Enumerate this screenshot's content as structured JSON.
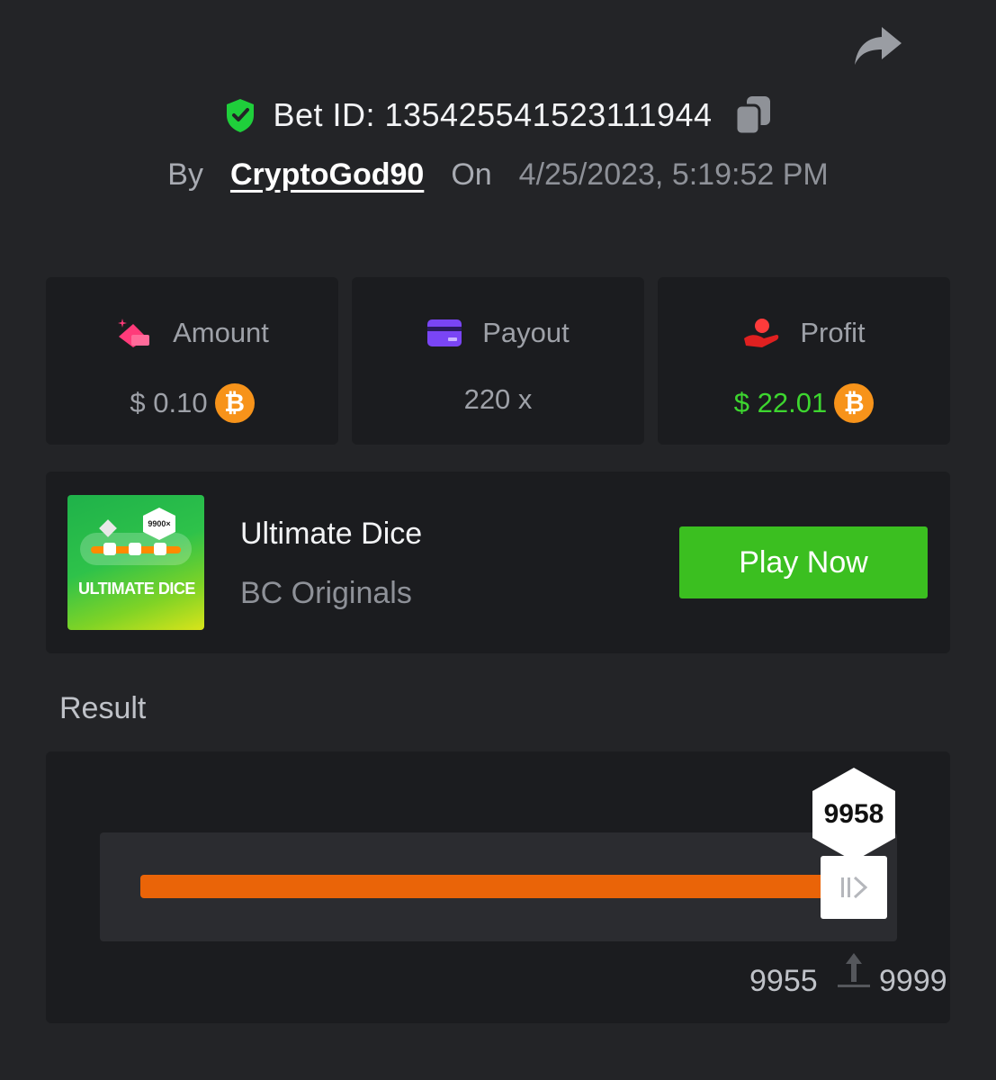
{
  "header": {
    "bet_id": "Bet ID: 135425541523111944",
    "by_label": "By",
    "username": "CryptoGod90",
    "on_label": "On",
    "datetime": "4/25/2023, 5:19:52 PM",
    "icons": {
      "verified": "shield-check-icon",
      "copy": "copy-icon",
      "share": "share-arrow-icon"
    },
    "colors": {
      "verified": "#1fcf3b"
    }
  },
  "stats": {
    "amount": {
      "label": "Amount",
      "value": "$ 0.10",
      "icon": "coins-icon",
      "currency_icon": "bitcoin-icon"
    },
    "payout": {
      "label": "Payout",
      "value": "220 x",
      "icon": "card-icon"
    },
    "profit": {
      "label": "Profit",
      "value": "$ 22.01",
      "icon": "hand-profit-icon",
      "currency_icon": "bitcoin-icon"
    },
    "colors": {
      "profit": "#3dd62f",
      "bitcoin": "#f7931a"
    }
  },
  "game": {
    "thumb_badge": "9900×",
    "thumb_title": "ULTIMATE DICE",
    "title": "Ultimate Dice",
    "provider": "BC Originals",
    "play_label": "Play Now",
    "colors": {
      "play_button": "#3bbf20"
    }
  },
  "result": {
    "label": "Result",
    "value": "9958",
    "range_min": "9955",
    "range_max": "9999",
    "colors": {
      "range": "#ea6408"
    }
  }
}
